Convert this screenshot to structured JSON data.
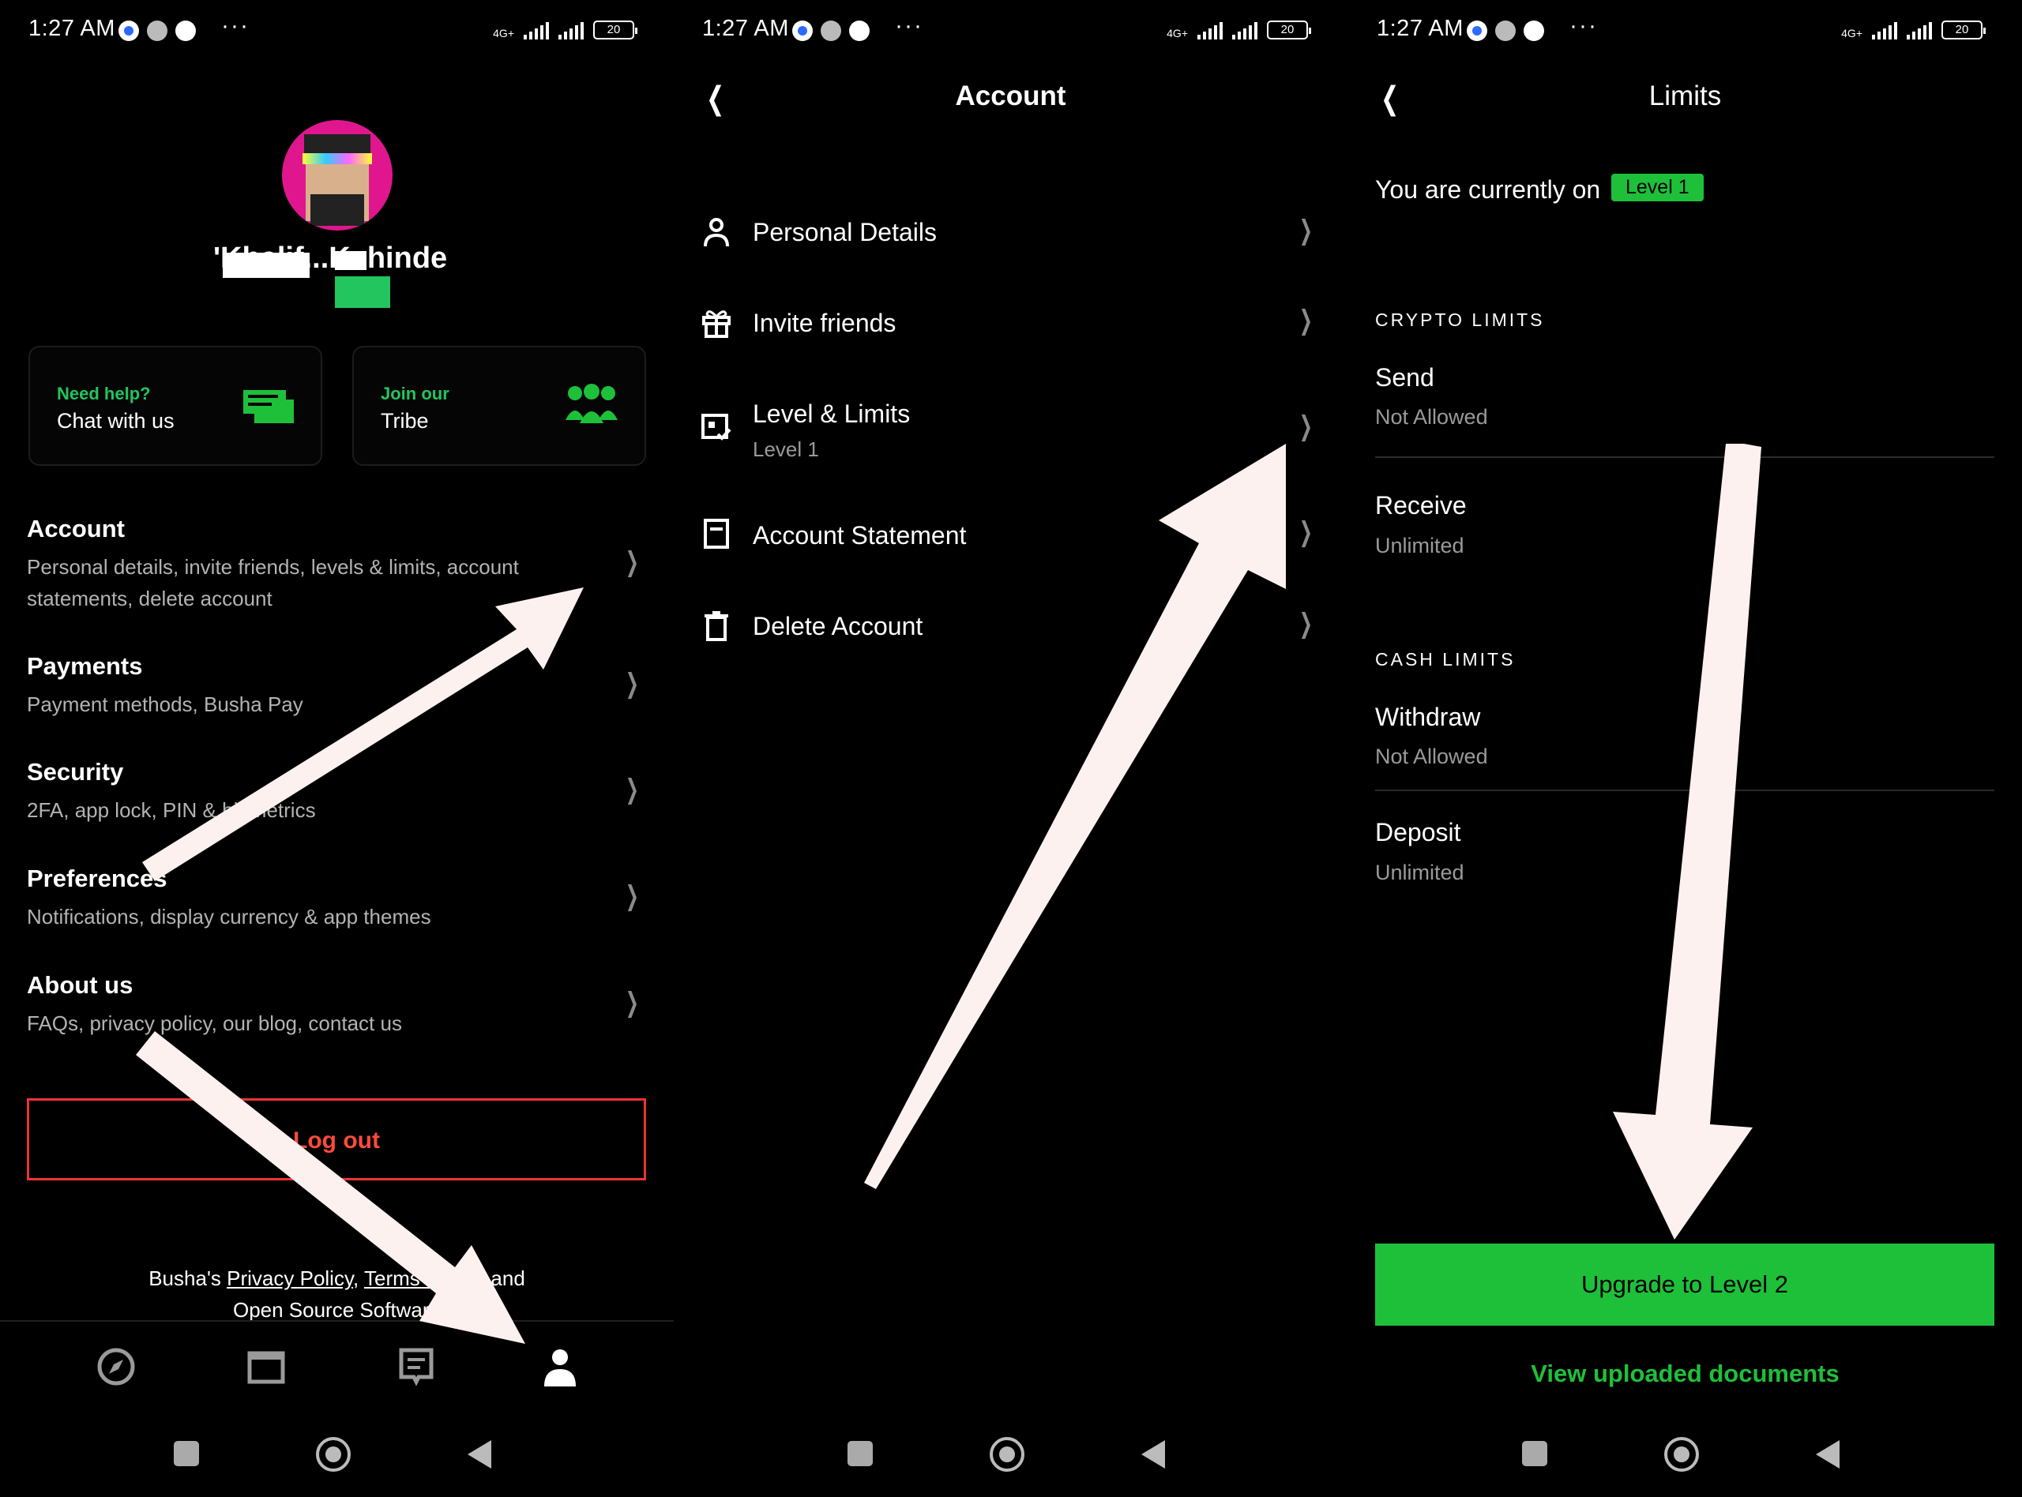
{
  "status_bar": {
    "time": "1:27 AM",
    "net": "4G+",
    "battery": "20",
    "more": "···"
  },
  "screen1": {
    "name": "'Khalif...Kehinde",
    "help_card": {
      "small": "Need help?",
      "big": "Chat with us",
      "icon": "chat-bubbles-icon"
    },
    "tribe_card": {
      "small": "Join our",
      "big": "Tribe",
      "icon": "people-group-icon"
    },
    "menu": [
      {
        "title": "Account",
        "subtitle": "Personal details, invite friends, levels & limits, account statements, delete account"
      },
      {
        "title": "Payments",
        "subtitle": "Payment methods, Busha Pay"
      },
      {
        "title": "Security",
        "subtitle": "2FA, app lock, PIN & biometrics"
      },
      {
        "title": "Preferences",
        "subtitle": "Notifications, display currency & app themes"
      },
      {
        "title": "About us",
        "subtitle": "FAQs, privacy policy, our blog, contact us"
      }
    ],
    "logout": "Log out",
    "footer": {
      "prefix": "Busha's ",
      "privacy": "Privacy Policy",
      "sep": ", ",
      "terms": "Terms of Use",
      "and": " and",
      "line2": "Open Source Software"
    },
    "tabs": [
      "compass-icon",
      "wallet-icon",
      "receipt-icon",
      "profile-icon"
    ]
  },
  "screen2": {
    "title": "Account",
    "rows": [
      {
        "label": "Personal Details",
        "sub": "",
        "icon": "person-icon"
      },
      {
        "label": "Invite friends",
        "sub": "",
        "icon": "gift-icon"
      },
      {
        "label": "Level & Limits",
        "sub": "Level 1",
        "icon": "id-card-check-icon"
      },
      {
        "label": "Account Statement",
        "sub": "",
        "icon": "document-icon"
      },
      {
        "label": "Delete Account",
        "sub": "",
        "icon": "trash-icon"
      }
    ]
  },
  "screen3": {
    "title": "Limits",
    "current_prefix": "You are currently on",
    "level_badge": "Level 1",
    "crypto_title": "CRYPTO LIMITS",
    "cash_title": "CASH LIMITS",
    "crypto": [
      {
        "label": "Send",
        "value": "Not Allowed"
      },
      {
        "label": "Receive",
        "value": "Unlimited"
      }
    ],
    "cash": [
      {
        "label": "Withdraw",
        "value": "Not Allowed"
      },
      {
        "label": "Deposit",
        "value": "Unlimited"
      }
    ],
    "upgrade": "Upgrade to Level 2",
    "docs_link": "View uploaded documents"
  },
  "colors": {
    "accent_green": "#1ec03a",
    "danger_red": "#ff4b3a",
    "arrow": "#fdf1ef",
    "avatar_bg": "#e0168f"
  }
}
